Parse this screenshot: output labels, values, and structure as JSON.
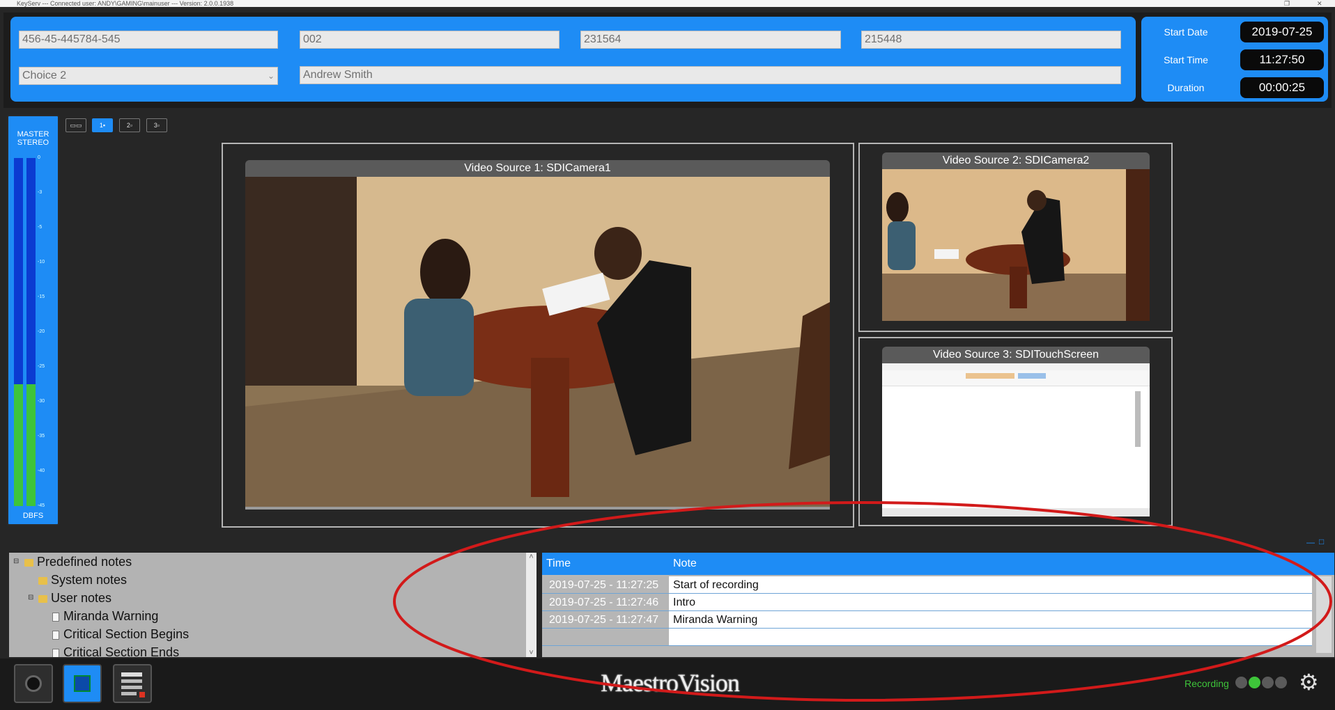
{
  "window": {
    "title": "KeyServ --- Connected user: ANDY\\GAMING\\mainuser --- Version: 2.0.0.1938",
    "restore_glyph": "❐",
    "close_glyph": "✕"
  },
  "header": {
    "fields": {
      "case_number": "456-45-445784-545",
      "field2": "002",
      "field3": "231564",
      "field4": "215448",
      "dropdown": "Choice 2",
      "dropdown_arrow": "⌄",
      "name": "Andrew Smith"
    },
    "start_date_label": "Start Date",
    "start_date": "2019-07-25",
    "start_time_label": "Start Time",
    "start_time": "11:27:50",
    "duration_label": "Duration",
    "duration": "00:00:25"
  },
  "vu_meter": {
    "top_label_1": "MASTER",
    "top_label_2": "STEREO",
    "bottom_label": "DBFS",
    "level": 0.35,
    "ticks": [
      "0",
      "-3",
      "-5",
      "-10",
      "-15",
      "-20",
      "-25",
      "-30",
      "-35",
      "-40",
      "-45"
    ]
  },
  "layout_buttons": [
    "",
    "1",
    "2",
    "3"
  ],
  "video_sources": [
    {
      "title": "Video Source 1: SDICamera1"
    },
    {
      "title": "Video Source 2: SDICamera2"
    },
    {
      "title": "Video Source 3: SDITouchScreen"
    }
  ],
  "notes": {
    "panel_controls": [
      "—",
      "□"
    ],
    "tree": [
      {
        "label": "Predefined notes",
        "level": 0,
        "kind": "folder",
        "expander": "⊟"
      },
      {
        "label": "System notes",
        "level": 1,
        "kind": "folder",
        "expander": ""
      },
      {
        "label": "User notes",
        "level": 1,
        "kind": "folder",
        "expander": "⊟"
      },
      {
        "label": "Miranda Warning",
        "level": 2,
        "kind": "doc",
        "expander": ""
      },
      {
        "label": "Critical Section Begins",
        "level": 2,
        "kind": "doc",
        "expander": ""
      },
      {
        "label": "Critical Section Ends",
        "level": 2,
        "kind": "doc",
        "expander": ""
      }
    ],
    "scroll_up": "˄",
    "scroll_down": "˅",
    "columns": {
      "time": "Time",
      "note": "Note"
    },
    "rows": [
      {
        "time": "2019-07-25 - 11:27:25",
        "note": "Start of recording"
      },
      {
        "time": "2019-07-25 - 11:27:46",
        "note": "Intro"
      },
      {
        "time": "2019-07-25 - 11:27:47",
        "note": "Miranda Warning"
      },
      {
        "time": "",
        "note": ""
      }
    ]
  },
  "footer": {
    "logo": "MaestroVision",
    "recording_label": "Recording",
    "status_colors": [
      "#5a5a5a",
      "#3ec43a",
      "#5a5a5a",
      "#5a5a5a"
    ],
    "gear_glyph": "⚙"
  }
}
